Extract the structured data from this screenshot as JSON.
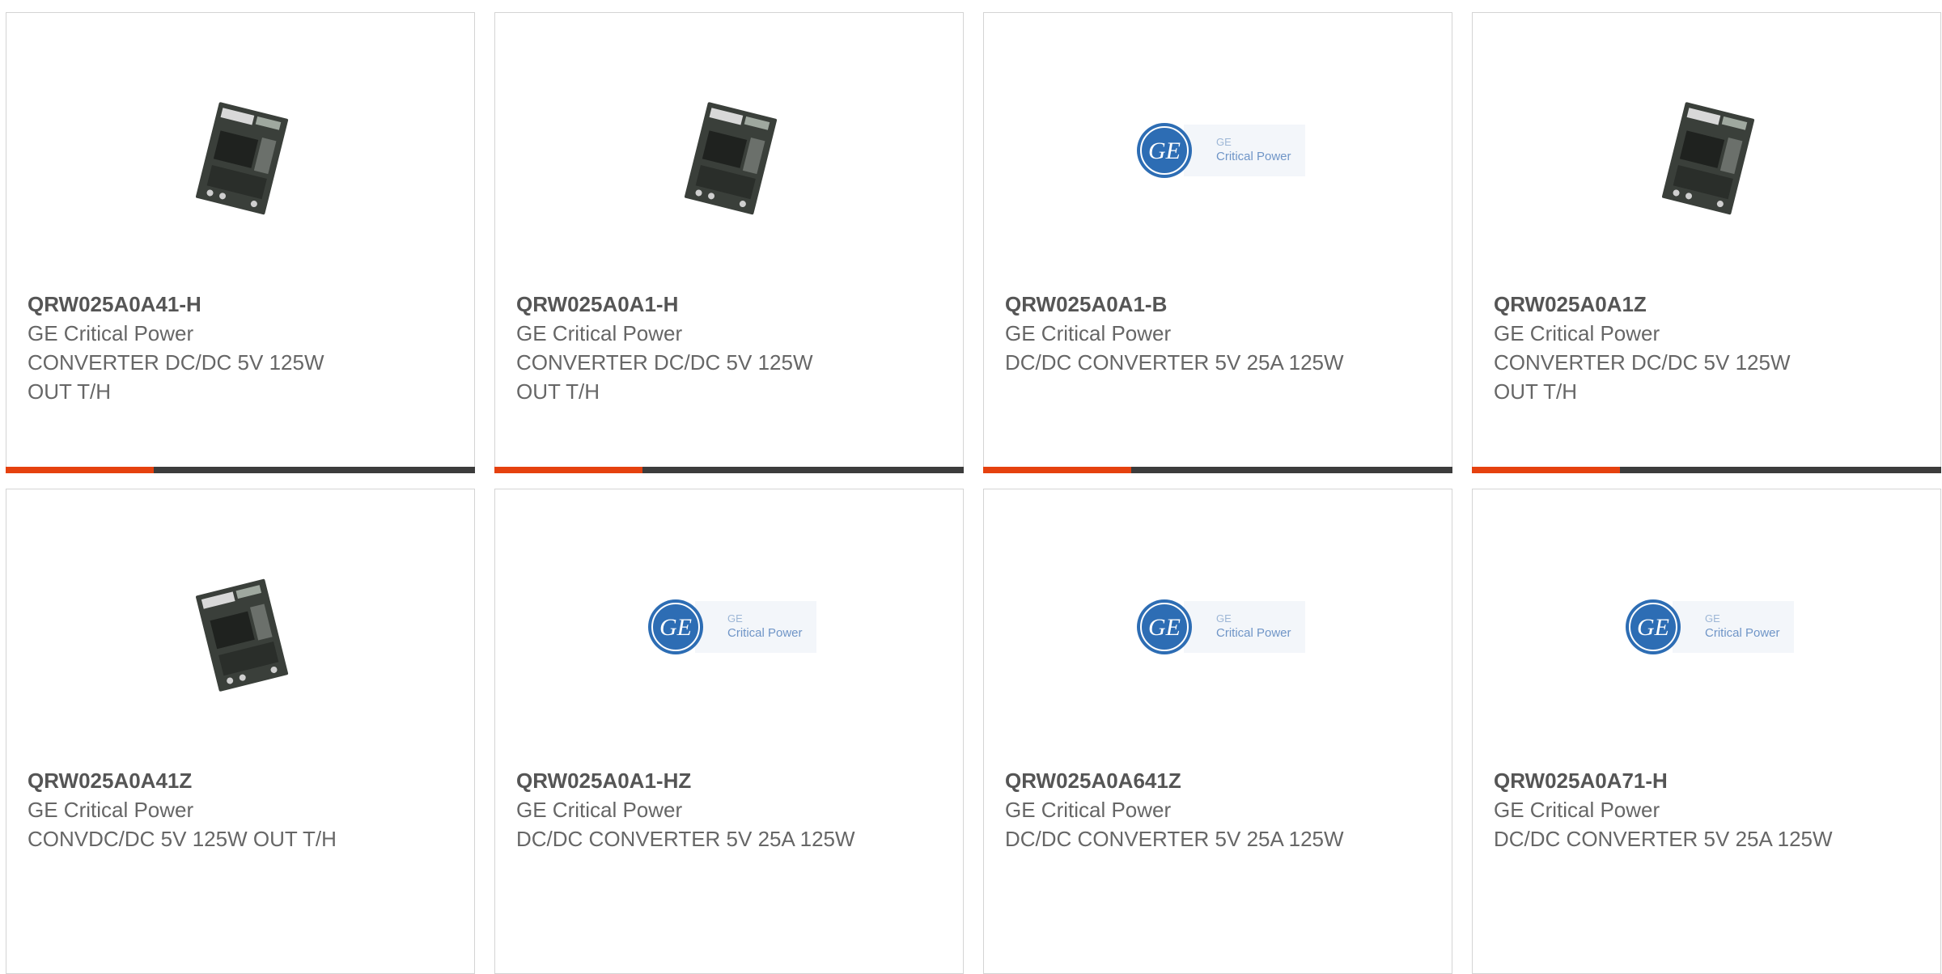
{
  "products": [
    {
      "part": "QRW025A0A41-H",
      "maker": "GE Critical Power",
      "desc": "CONVERTER DC/DC 5V 125W OUT T/H",
      "image": "power-module-photo"
    },
    {
      "part": "QRW025A0A1-H",
      "maker": "GE Critical Power",
      "desc": "CONVERTER DC/DC 5V 125W OUT T/H",
      "image": "power-module-photo"
    },
    {
      "part": "QRW025A0A1-B",
      "maker": "GE Critical Power",
      "desc": "DC/DC CONVERTER 5V 25A 125W",
      "image": "ge-critical-power-logo"
    },
    {
      "part": "QRW025A0A1Z",
      "maker": "GE Critical Power",
      "desc": "CONVERTER DC/DC 5V 125W OUT T/H",
      "image": "power-module-photo"
    },
    {
      "part": "QRW025A0A41Z",
      "maker": "GE Critical Power",
      "desc": "CONVDC/DC 5V 125W OUT T/H",
      "image": "power-module-photo"
    },
    {
      "part": "QRW025A0A1-HZ",
      "maker": "GE Critical Power",
      "desc": "DC/DC CONVERTER 5V 25A 125W",
      "image": "ge-critical-power-logo"
    },
    {
      "part": "QRW025A0A641Z",
      "maker": "GE Critical Power",
      "desc": "DC/DC CONVERTER 5V 25A 125W",
      "image": "ge-critical-power-logo"
    },
    {
      "part": "QRW025A0A71-H",
      "maker": "GE Critical Power",
      "desc": "DC/DC CONVERTER 5V 25A 125W",
      "image": "ge-critical-power-logo"
    }
  ],
  "logo": {
    "line1": "GE",
    "line2": "Critical Power",
    "monogram": "GE"
  },
  "colors": {
    "accent": "#e5410f",
    "bar": "#3c3c3c",
    "ge_blue": "#2d6db4"
  }
}
